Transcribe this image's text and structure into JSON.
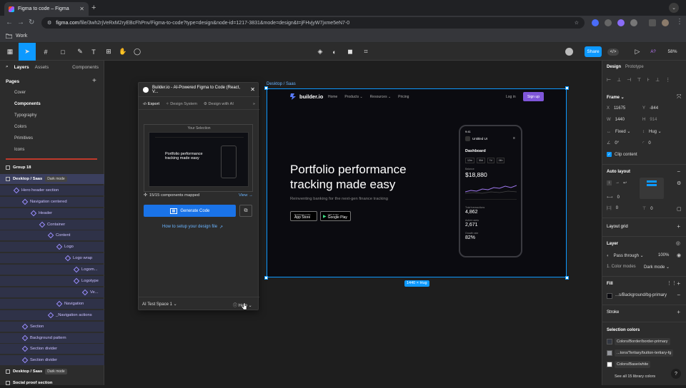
{
  "browser": {
    "tab_title": "Figma to code – Figma",
    "new_tab": "+",
    "url_domain": "figma.com",
    "url_path": "/file/3wh2rjVeRxM2ryEBcFhPnv/Figma-to-code?type=design&node-id=1217-3831&mode=design&t=jFHvjyW7jxme5eN7-0",
    "bookmark": "Work"
  },
  "toolbar": {
    "share": "Share",
    "zoom": "58%",
    "font_hint": "A?"
  },
  "left_panel": {
    "tab_layers": "Layers",
    "tab_assets": "Assets",
    "components_dropdown": "Components",
    "pages_title": "Pages",
    "pages": [
      "Cover",
      "Components",
      "Typography",
      "Colors",
      "Primitives",
      "Icons"
    ],
    "layers": [
      {
        "label": "Group 18",
        "indent": 0
      },
      {
        "label": "Desktop / Saas",
        "indent": 0,
        "badge": "Dark mode",
        "selected": true
      },
      {
        "label": "Hero header section",
        "indent": 1
      },
      {
        "label": "Navigation centered",
        "indent": 2
      },
      {
        "label": "Header",
        "indent": 3
      },
      {
        "label": "Container",
        "indent": 4
      },
      {
        "label": "Content",
        "indent": 5
      },
      {
        "label": "Logo",
        "indent": 6
      },
      {
        "label": "Logo wrap",
        "indent": 7
      },
      {
        "label": "Logom...",
        "indent": 8
      },
      {
        "label": "Logotype",
        "indent": 8
      },
      {
        "label": "Ve...",
        "indent": 9
      },
      {
        "label": "Navigation",
        "indent": 6
      },
      {
        "label": "_Navigation actions",
        "indent": 5
      },
      {
        "label": "Section",
        "indent": 2
      },
      {
        "label": "Background pattern",
        "indent": 2
      },
      {
        "label": "Section divider",
        "indent": 2
      },
      {
        "label": "Section divider",
        "indent": 2
      },
      {
        "label": "Desktop / Saas",
        "indent": 0,
        "badge": "Dark mode"
      },
      {
        "label": "Social proof section",
        "indent": 0
      }
    ]
  },
  "plugin": {
    "title": "Builder.io - AI-Powered Figma to Code (React, V...",
    "tabs": [
      "Export",
      "Design System",
      "Design with AI"
    ],
    "your_selection": "Your Selection",
    "preview_headline": "Portfolio performance tracking made easy",
    "components_mapped": "15/15 components mapped",
    "view_link": "View →",
    "generate_button": "Generate Code",
    "setup_link": "How to setup your design file",
    "workspace": "AI Test Space 1",
    "help": "Help"
  },
  "design": {
    "frame_label": "Desktop / Saas",
    "size_label": "1440 × Hug",
    "logo": "builder.io",
    "nav": [
      "Home",
      "Products",
      "Resources",
      "Pricing"
    ],
    "login": "Log in",
    "signup": "Sign up",
    "headline": "Portfolio performance tracking made easy",
    "subhead": "Reinventing banking for the next-gen finance tracking",
    "app_store_small": "Download on the",
    "app_store": "App Store",
    "google_play_small": "GET IT ON",
    "google_play": "Google Play",
    "phone": {
      "time": "9:41",
      "app_name": "Untitled UI",
      "dashboard": "Dashboard",
      "ranges": [
        "12m",
        "30d",
        "7d",
        "24h"
      ],
      "balance_label": "Balance",
      "balance": "$18,880",
      "stat1_label": "Total transactions",
      "stat1": "4,862",
      "stat2_label": "Active users",
      "stat2": "2,671",
      "stat3_label": "Growth rate",
      "stat3": "82%"
    }
  },
  "right_panel": {
    "tab_design": "Design",
    "tab_prototype": "Prototype",
    "frame_title": "Frame",
    "x": "11675",
    "y": "-844",
    "w": "1440",
    "h": "914",
    "w_mode": "Fixed",
    "h_mode": "Hug",
    "rotation": "0°",
    "radius": "0",
    "clip_content": "Clip content",
    "auto_layout": "Auto layout",
    "gap": "0",
    "padding_h": "0",
    "padding_v": "0",
    "layout_grid": "Layout grid",
    "layer": "Layer",
    "pass_through": "Pass through",
    "opacity": "100%",
    "color_modes": "1. Color modes",
    "dark_mode": "Dark mode",
    "fill": "Fill",
    "fill_value": "...s/Background/bg-primary",
    "stroke": "Stroke",
    "selection_colors": "Selection colors",
    "colors": [
      {
        "name": "Colors/Border/border-primary",
        "hex": "#333741"
      },
      {
        "name": "...tons/Tertiary/button-tertiary-fg",
        "hex": "#94969c"
      },
      {
        "name": "Colors/Base/white",
        "hex": "#ffffff"
      }
    ],
    "see_all": "See all 15 library colors"
  },
  "colors": {
    "accent": "#0d99ff",
    "layer_purple": "#9c8fff",
    "signup": "#7f56d9",
    "generate": "#1a73e8"
  }
}
